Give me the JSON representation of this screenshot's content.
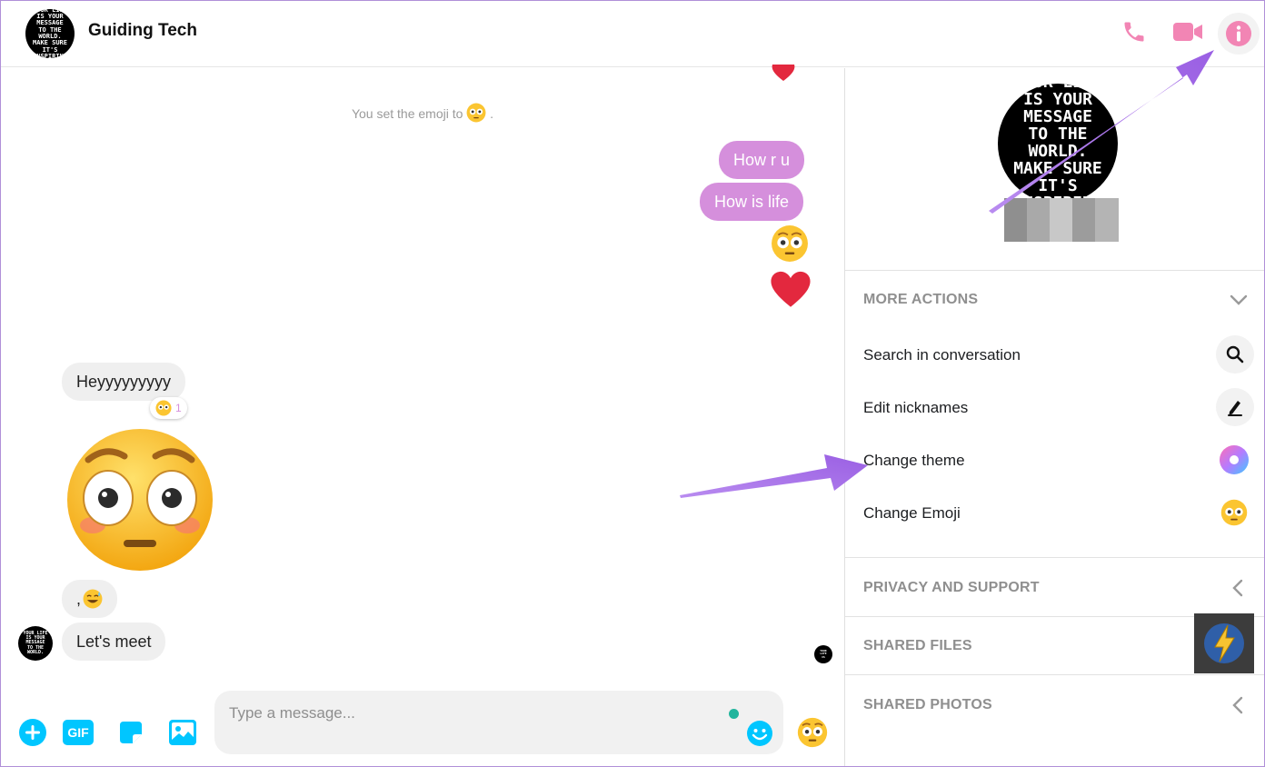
{
  "header": {
    "contact_name": "Guiding Tech",
    "avatar_text": "YOUR LIFE IS YOUR MESSAGE TO THE WORLD. MAKE SURE IT'S INSPIRING"
  },
  "chat": {
    "system_message": "You set the emoji to",
    "system_message_end": ".",
    "outgoing": [
      "How r u",
      "How is life"
    ],
    "incoming": [
      "Heyyyyyyyyy",
      ",",
      "Let's meet"
    ],
    "reaction_count": "1"
  },
  "composer": {
    "placeholder": "Type a message...",
    "gif_label": "GIF"
  },
  "panel": {
    "more_actions": "MORE ACTIONS",
    "actions": [
      {
        "label": "Search in conversation",
        "icon": "search-icon"
      },
      {
        "label": "Edit nicknames",
        "icon": "pencil-icon"
      },
      {
        "label": "Change theme",
        "icon": "theme-icon"
      },
      {
        "label": "Change Emoji",
        "icon": "flushed-emoji-icon"
      }
    ],
    "privacy": "PRIVACY AND SUPPORT",
    "shared_files": "SHARED FILES",
    "shared_photos": "SHARED PHOTOS"
  },
  "colors": {
    "accent_pink": "#f285b4",
    "bubble_out": "#d58fdc",
    "composer_cyan": "#00c6ff",
    "annotation_arrow": "#a46ee8"
  }
}
